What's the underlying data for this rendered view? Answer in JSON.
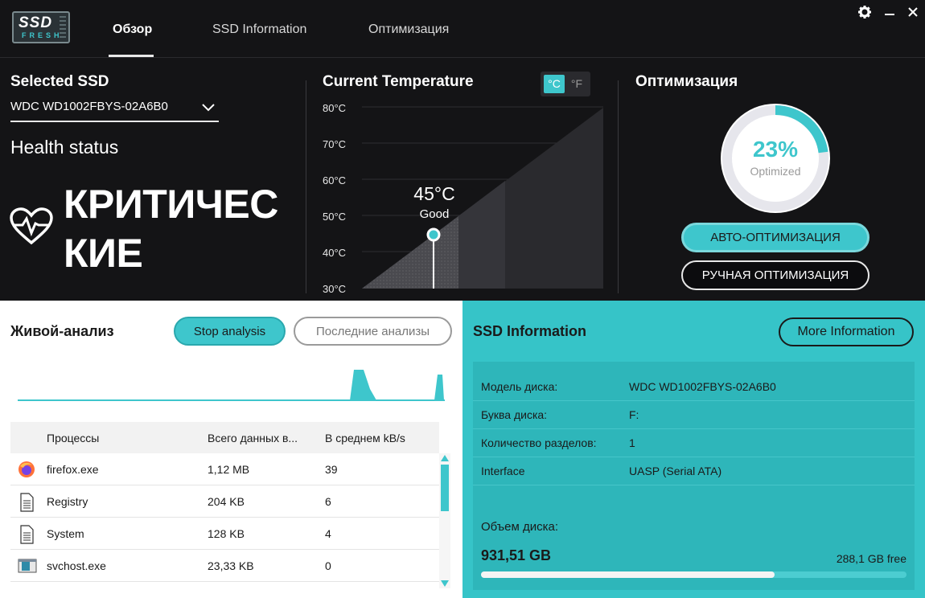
{
  "app": {
    "logo_top": "SSD",
    "logo_bottom": "FRESH",
    "tabs": [
      {
        "label": "Обзор",
        "active": true
      },
      {
        "label": "SSD Information",
        "active": false
      },
      {
        "label": "Оптимизация",
        "active": false
      }
    ],
    "window_controls": [
      "gear-icon",
      "minimize-icon",
      "close-icon"
    ]
  },
  "selected_ssd": {
    "title": "Selected SSD",
    "value": "WDC WD1002FBYS-02A6B0",
    "health_label": "Health status",
    "health_value": "КРИТИЧЕСКИЕ"
  },
  "temperature": {
    "title": "Current Temperature",
    "units": [
      "°C",
      "°F"
    ],
    "active_unit": "°C",
    "ticks": [
      "80°C",
      "70°C",
      "60°C",
      "50°C",
      "40°C",
      "30°C"
    ],
    "current": "45°C",
    "status": "Good",
    "current_value": 45,
    "range": [
      30,
      80
    ]
  },
  "optimization": {
    "title": "Оптимизация",
    "percent": "23%",
    "percent_value": 23,
    "subtitle": "Optimized",
    "auto_button": "АВТО-ОПТИМИЗАЦИЯ",
    "manual_button": "РУЧНАЯ ОПТИМИЗАЦИЯ"
  },
  "live_analysis": {
    "title": "Живой-анализ",
    "stop_button": "Stop analysis",
    "recent_button": "Последние анализы",
    "columns": [
      "Процессы",
      "Всего данных в...",
      "В среднем kB/s"
    ],
    "rows": [
      {
        "icon": "firefox-icon",
        "process": "firefox.exe",
        "total": "1,12 MB",
        "avg": "39"
      },
      {
        "icon": "document-icon",
        "process": "Registry",
        "total": "204 KB",
        "avg": "6"
      },
      {
        "icon": "document-icon",
        "process": "System",
        "total": "128 KB",
        "avg": "4"
      },
      {
        "icon": "window-app-icon",
        "process": "svchost.exe",
        "total": "23,33 KB",
        "avg": "0"
      }
    ]
  },
  "ssd_info": {
    "title": "SSD Information",
    "more_button": "More Information",
    "fields": [
      {
        "key": "Модель диска:",
        "value": "WDC WD1002FBYS-02A6B0"
      },
      {
        "key": "Буква диска:",
        "value": "F:"
      },
      {
        "key": "Количество разделов:",
        "value": "1"
      },
      {
        "key": "Interface",
        "value": "UASP (Serial ATA)"
      }
    ],
    "volume_label": "Объем диска:",
    "volume_size": "931,51 GB",
    "volume_free": "288,1 GB free",
    "used_fraction": 0.69
  },
  "colors": {
    "accent": "#3ec6cc",
    "dark_bg": "#141416",
    "info_bg": "#36c4c8"
  }
}
